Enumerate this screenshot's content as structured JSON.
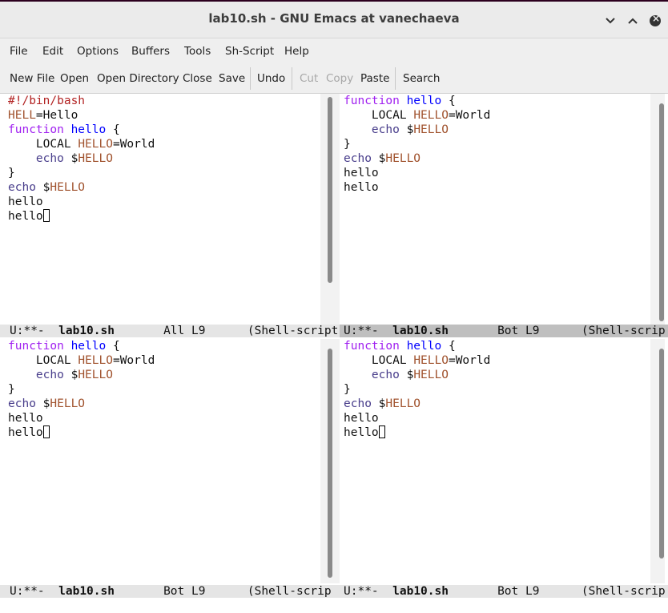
{
  "window": {
    "title": "lab10.sh - GNU Emacs at vanechaeva",
    "minimize_icon": "chevron-down-icon",
    "maximize_icon": "chevron-up-icon",
    "close_icon": "close-icon"
  },
  "menu": [
    "File",
    "Edit",
    "Options",
    "Buffers",
    "Tools",
    "Sh-Script",
    "Help"
  ],
  "toolbar": {
    "new_file": "New File",
    "open": "Open",
    "open_directory": "Open Directory",
    "close": "Close",
    "save": "Save",
    "undo": "Undo",
    "cut": "Cut",
    "copy": "Copy",
    "paste": "Paste",
    "search": "Search"
  },
  "panes": {
    "top_left": {
      "lines": [
        "#!/bin/bash",
        "HELL=Hello",
        "function hello {",
        "    LOCAL HELLO=World",
        "    echo $HELLO",
        "}",
        "echo $HELLO",
        "hello",
        "hello"
      ],
      "modeline": {
        "status": "U:**-",
        "buffer": "lab10.sh",
        "position": "All L9",
        "mode": "(Shell-script"
      }
    },
    "top_right": {
      "lines": [
        "function hello {",
        "    LOCAL HELLO=World",
        "    echo $HELLO",
        "}",
        "echo $HELLO",
        "hello",
        "hello"
      ],
      "modeline": {
        "status": "U:**-",
        "buffer": "lab10.sh",
        "position": "Bot L9",
        "mode": "(Shell-scrip"
      }
    },
    "bottom_left": {
      "lines": [
        "function hello {",
        "    LOCAL HELLO=World",
        "    echo $HELLO",
        "}",
        "echo $HELLO",
        "hello",
        "hello"
      ],
      "modeline": {
        "status": "U:**-",
        "buffer": "lab10.sh",
        "position": "Bot L9",
        "mode": "(Shell-scrip"
      }
    },
    "bottom_right": {
      "lines": [
        "function hello {",
        "    LOCAL HELLO=World",
        "    echo $HELLO",
        "}",
        "echo $HELLO",
        "hello",
        "hello"
      ],
      "modeline": {
        "status": "U:**-",
        "buffer": "lab10.sh",
        "position": "Bot L9",
        "mode": "(Shell-scrip"
      }
    }
  },
  "colors": {
    "comment": "#b22222",
    "keyword": "#a020f0",
    "function_name": "#0000ff",
    "variable": "#a0522d",
    "builtin": "#483d8b"
  }
}
